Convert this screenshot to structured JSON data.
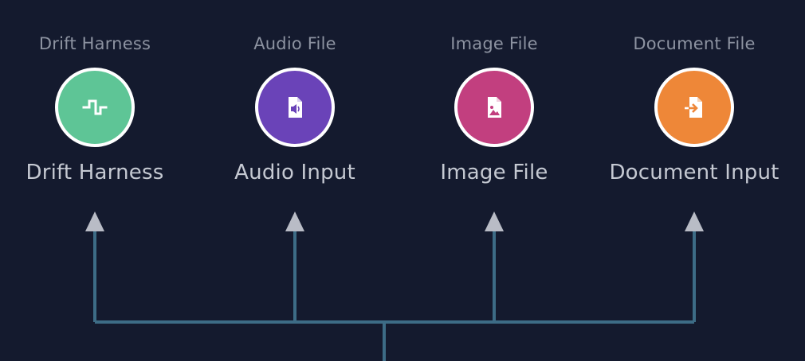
{
  "connector_color": "#3d6c86",
  "arrow_color": "#b9bcc6",
  "nodes": [
    {
      "caption": "Drift Harness",
      "title": "Drift Harness",
      "icon": "square-wave-icon",
      "color": "#5ec596"
    },
    {
      "caption": "Audio File",
      "title": "Audio Input",
      "icon": "audio-file-icon",
      "color": "#6a43b8"
    },
    {
      "caption": "Image File",
      "title": "Image File",
      "icon": "image-file-icon",
      "color": "#c23f7f"
    },
    {
      "caption": "Document File",
      "title": "Document Input",
      "icon": "document-import-icon",
      "color": "#ee8738"
    }
  ]
}
